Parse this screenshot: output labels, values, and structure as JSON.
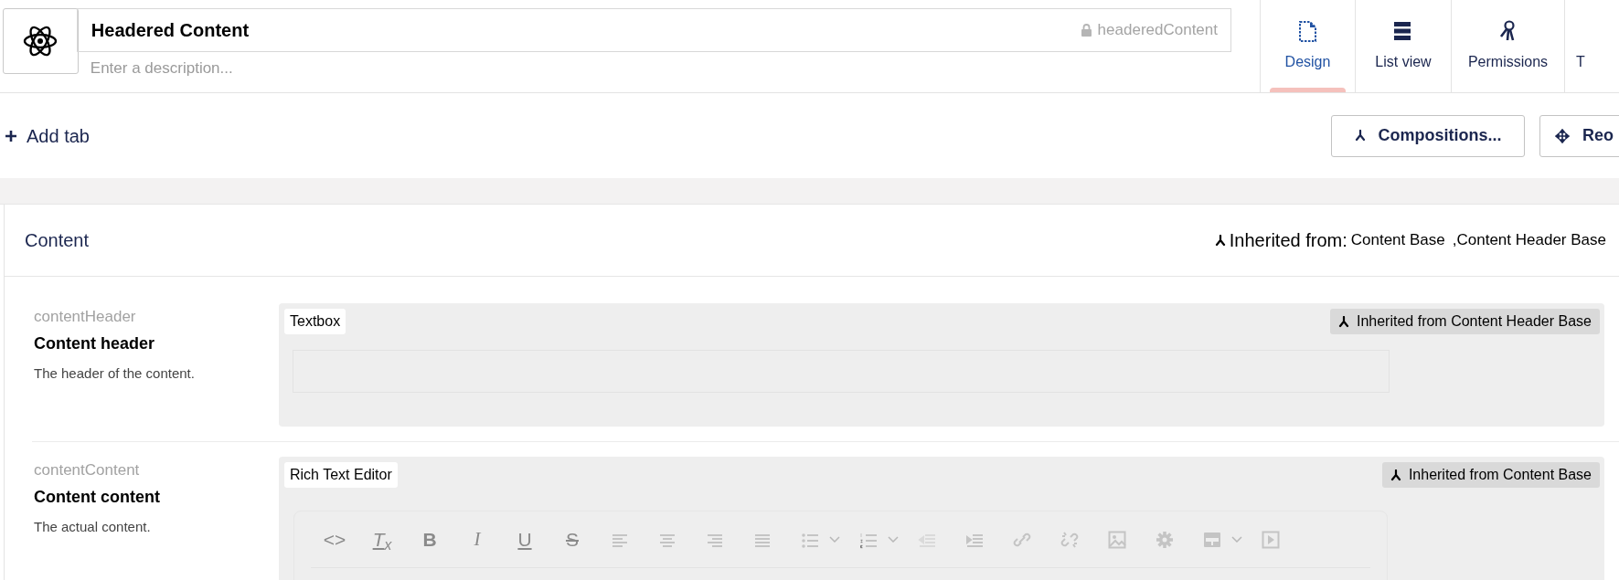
{
  "header": {
    "name": "Headered Content",
    "description_placeholder": "Enter a description...",
    "alias": "headeredContent",
    "alias_locked": true
  },
  "tabs": [
    {
      "label": "Design",
      "kind": "design",
      "selected": true
    },
    {
      "label": "List view",
      "kind": "list",
      "selected": false
    },
    {
      "label": "Permissions",
      "kind": "permissions",
      "selected": false
    },
    {
      "label": "T",
      "kind": "cut",
      "selected": false
    }
  ],
  "toolbar": {
    "add_tab": "Add tab",
    "buttons": [
      {
        "label": "Compositions...",
        "kind": "compositions"
      },
      {
        "label": "Reo",
        "kind": "reorder"
      }
    ]
  },
  "group": {
    "title": "Content",
    "inherited_label": "Inherited from:",
    "inherited_sources": [
      "Content Base",
      "Content Header Base"
    ],
    "separator": ",",
    "properties": [
      {
        "alias": "contentHeader",
        "name": "Content header",
        "description": "The header of the content.",
        "editor": "Textbox",
        "kind": "textbox",
        "inherited": "Inherited from Content Header Base"
      },
      {
        "alias": "contentContent",
        "name": "Content content",
        "description": "The actual content.",
        "editor": "Rich Text Editor",
        "kind": "rte",
        "inherited": "Inherited from Content Base",
        "tools": [
          {
            "kind": "code",
            "text": "<>"
          },
          {
            "kind": "clear",
            "text": "T$_{x}$"
          },
          {
            "kind": "bold",
            "text": "B"
          },
          {
            "kind": "italic",
            "text": "I"
          },
          {
            "kind": "underline",
            "text": "U"
          },
          {
            "kind": "strike",
            "text": "S"
          },
          {
            "kind": "align-left"
          },
          {
            "kind": "align-center"
          },
          {
            "kind": "align-right"
          },
          {
            "kind": "justify"
          },
          {
            "kind": "bullets"
          },
          {
            "kind": "chevron"
          },
          {
            "kind": "numbers"
          },
          {
            "kind": "chevron"
          },
          {
            "kind": "outdent"
          },
          {
            "kind": "indent"
          },
          {
            "kind": "link"
          },
          {
            "kind": "unlink"
          },
          {
            "kind": "image"
          },
          {
            "kind": "gear"
          },
          {
            "kind": "table"
          },
          {
            "kind": "chevron"
          },
          {
            "kind": "media"
          }
        ]
      }
    ]
  }
}
